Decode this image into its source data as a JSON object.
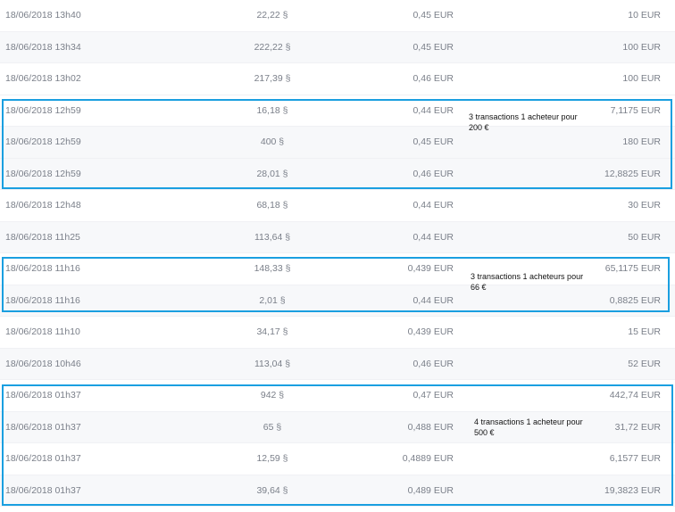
{
  "transactions": [
    {
      "date": "18/06/2018 13h40",
      "amount": "22,22 §",
      "price": "0,45 EUR",
      "total": "10 EUR"
    },
    {
      "date": "18/06/2018 13h34",
      "amount": "222,22 §",
      "price": "0,45 EUR",
      "total": "100 EUR"
    },
    {
      "date": "18/06/2018 13h02",
      "amount": "217,39 §",
      "price": "0,46 EUR",
      "total": "100 EUR"
    },
    {
      "date": "18/06/2018 12h59",
      "amount": "16,18 §",
      "price": "0,44 EUR",
      "total": "7,1175 EUR"
    },
    {
      "date": "18/06/2018 12h59",
      "amount": "400 §",
      "price": "0,45 EUR",
      "total": "180 EUR"
    },
    {
      "date": "18/06/2018 12h59",
      "amount": "28,01 §",
      "price": "0,46 EUR",
      "total": "12,8825 EUR"
    },
    {
      "date": "18/06/2018 12h48",
      "amount": "68,18 §",
      "price": "0,44 EUR",
      "total": "30 EUR"
    },
    {
      "date": "18/06/2018 11h25",
      "amount": "113,64 §",
      "price": "0,44 EUR",
      "total": "50 EUR"
    },
    {
      "date": "18/06/2018 11h16",
      "amount": "148,33 §",
      "price": "0,439 EUR",
      "total": "65,1175 EUR"
    },
    {
      "date": "18/06/2018 11h16",
      "amount": "2,01 §",
      "price": "0,44 EUR",
      "total": "0,8825 EUR"
    },
    {
      "date": "18/06/2018 11h10",
      "amount": "34,17 §",
      "price": "0,439 EUR",
      "total": "15 EUR"
    },
    {
      "date": "18/06/2018 10h46",
      "amount": "113,04 §",
      "price": "0,46 EUR",
      "total": "52 EUR"
    },
    {
      "date": "18/06/2018 01h37",
      "amount": "942 §",
      "price": "0,47 EUR",
      "total": "442,74 EUR"
    },
    {
      "date": "18/06/2018 01h37",
      "amount": "65 §",
      "price": "0,488 EUR",
      "total": "31,72 EUR"
    },
    {
      "date": "18/06/2018 01h37",
      "amount": "12,59 §",
      "price": "0,4889 EUR",
      "total": "6,1577 EUR"
    },
    {
      "date": "18/06/2018 01h37",
      "amount": "39,64 §",
      "price": "0,489 EUR",
      "total": "19,3823 EUR"
    }
  ],
  "annotations": [
    {
      "line1": "3 transactions 1 acheteur pour",
      "line2": "200 €"
    },
    {
      "line1": "3 transactions 1 acheteurs pour",
      "line2": "66 €"
    },
    {
      "line1": "4 transactions 1 acheteur pour",
      "line2": "500 €"
    }
  ],
  "colors": {
    "highlight_border": "#1a9fe0",
    "text": "#7a7f89",
    "annotation_text": "#111111",
    "row_alt_bg": "#f7f8fa"
  }
}
